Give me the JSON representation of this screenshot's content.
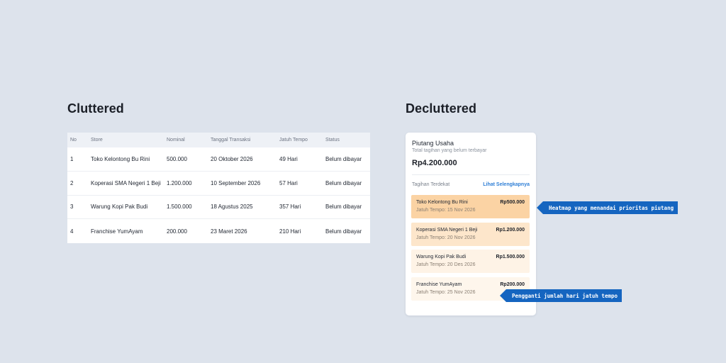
{
  "titles": {
    "cluttered": "Cluttered",
    "decluttered": "Decluttered"
  },
  "table": {
    "headers": [
      "No",
      "Store",
      "Nominal",
      "Tanggal Transaksi",
      "Jatuh Tempo",
      "Status"
    ],
    "rows": [
      [
        "1",
        "Toko Kelontong Bu Rini",
        "500.000",
        "20 Oktober 2026",
        "49 Hari",
        "Belum dibayar"
      ],
      [
        "2",
        "Koperasi SMA Negeri 1 Beji",
        "1.200.000",
        "10 September 2026",
        "57 Hari",
        "Belum dibayar"
      ],
      [
        "3",
        "Warung Kopi Pak Budi",
        "1.500.000",
        "18 Agustus 2025",
        "357 Hari",
        "Belum dibayar"
      ],
      [
        "4",
        "Franchise YumAyam",
        "200.000",
        "23 Maret 2026",
        "210 Hari",
        "Belum dibayar"
      ]
    ]
  },
  "card": {
    "title": "Piutang Usaha",
    "subtitle": "Total tagihan yang belum terbayar",
    "total": "Rp4.200.000",
    "section_label": "Tagihan Terdekat",
    "link": "Lihat Selengkapnya",
    "bills": [
      {
        "name": "Toko Kelontong Bu Rini",
        "amount": "Rp500.000",
        "due": "Jatuh Tempo: 15 Nov 2026",
        "color": "#fbd3a4"
      },
      {
        "name": "Koperasi SMA Negeri 1 Beji",
        "amount": "Rp1.200.000",
        "due": "Jatuh Tempo: 20 Nov 2026",
        "color": "#fde6cb"
      },
      {
        "name": "Warung Kopi Pak Budi",
        "amount": "Rp1.500.000",
        "due": "Jatuh Tempo: 20 Des 2026",
        "color": "#fef3e6"
      },
      {
        "name": "Franchise YumAyam",
        "amount": "Rp200.000",
        "due": "Jatuh Tempo: 25 Nov 2026",
        "color": "#fef6ec"
      }
    ]
  },
  "callouts": {
    "heatmap": "Heatmap yang menandai prioritas piutang",
    "replacement": "Pengganti jumlah hari jatuh tempo"
  },
  "colors": {
    "background": "#dde3ec",
    "callout": "#1565c0",
    "link": "#2f7fd6"
  }
}
